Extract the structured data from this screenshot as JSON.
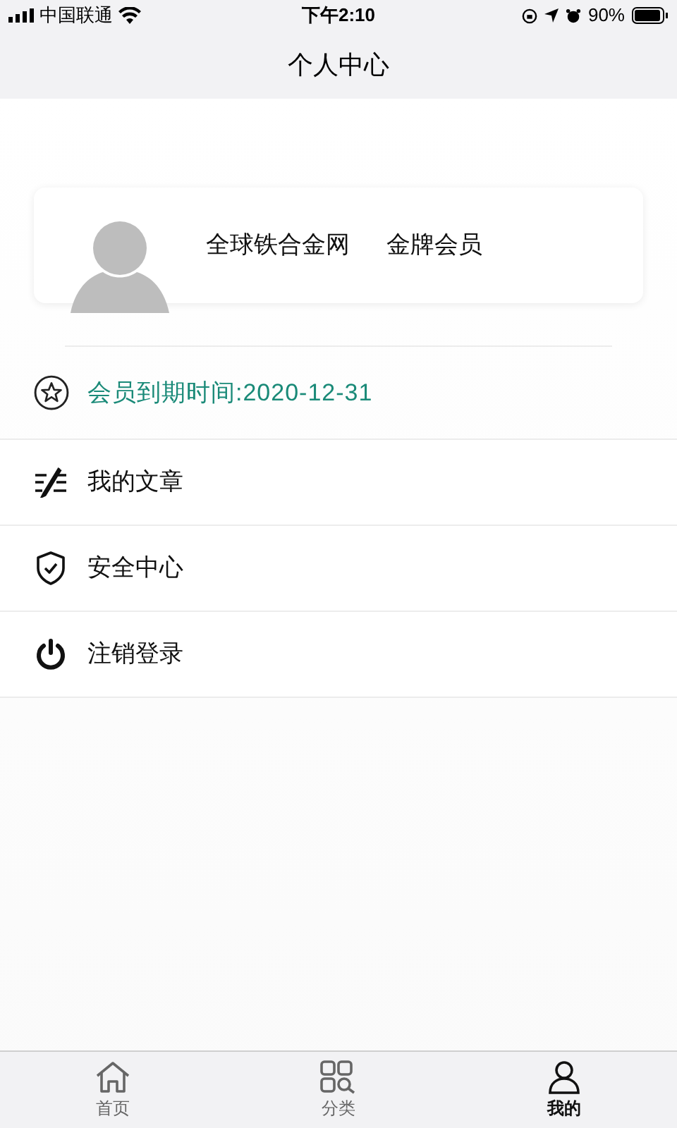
{
  "status_bar": {
    "carrier": "中国联通",
    "time": "下午2:10",
    "battery": "90%"
  },
  "nav": {
    "title": "个人中心"
  },
  "profile": {
    "name": "全球铁合金网",
    "level": "金牌会员"
  },
  "membership": {
    "text": "会员到期时间:2020-12-31"
  },
  "menu": [
    {
      "kind": "articles",
      "label": "我的文章"
    },
    {
      "kind": "security",
      "label": "安全中心"
    },
    {
      "kind": "logout",
      "label": "注销登录"
    }
  ],
  "tabs": [
    {
      "kind": "home",
      "label": "首页",
      "selected": false
    },
    {
      "kind": "category",
      "label": "分类",
      "selected": false
    },
    {
      "kind": "me",
      "label": "我的",
      "selected": true
    }
  ]
}
